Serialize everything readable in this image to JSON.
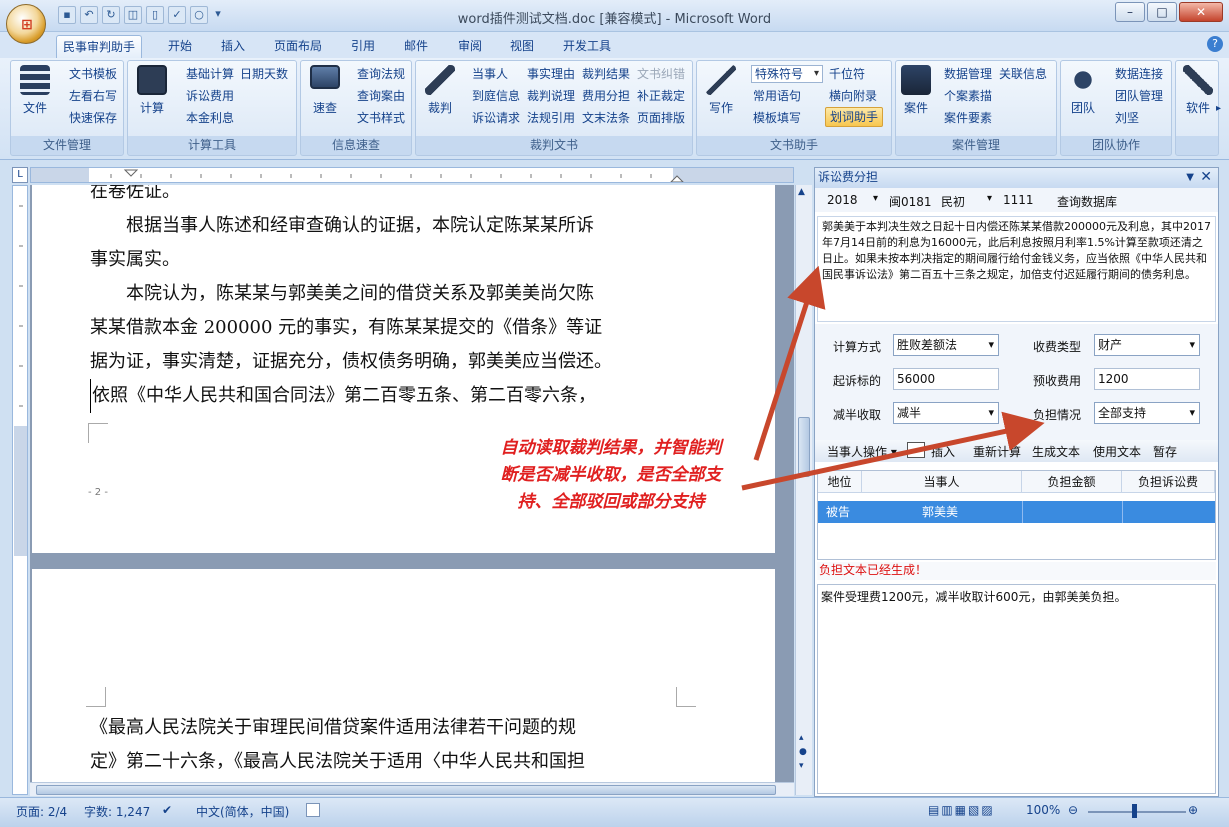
{
  "window": {
    "title": "word插件测试文档.doc [兼容模式] - Microsoft Word",
    "min": "–",
    "max": "□",
    "close": "✕"
  },
  "tabs": [
    "民事审判助手",
    "开始",
    "插入",
    "页面布局",
    "引用",
    "邮件",
    "审阅",
    "视图",
    "开发工具"
  ],
  "ribbon": {
    "file_group": {
      "label": "文件管理",
      "big": "文件",
      "items": [
        "文书模板",
        "左看右写",
        "快速保存"
      ]
    },
    "calc_group": {
      "label": "计算工具",
      "big": "计算",
      "items": [
        "基础计算",
        "日期天数",
        "诉讼费用",
        "本金利息"
      ]
    },
    "info_group": {
      "label": "信息速查",
      "big": "速查",
      "items": [
        "查询法规",
        "查询案由",
        "文书样式"
      ]
    },
    "judge_group": {
      "label": "裁判文书",
      "big": "裁判",
      "items": [
        "当事人",
        "事实理由",
        "裁判结果",
        "文书纠错",
        "到庭信息",
        "裁判说理",
        "费用分担",
        "补正裁定",
        "诉讼请求",
        "法规引用",
        "文末法条",
        "页面排版"
      ]
    },
    "write_group": {
      "label": "文书助手",
      "big": "写作",
      "combo": "特殊符号",
      "items": [
        "千位符",
        "常用语句",
        "横向附录",
        "模板填写"
      ],
      "highlight": "划词助手"
    },
    "case_group": {
      "label": "案件管理",
      "big": "案件",
      "items": [
        "数据管理",
        "关联信息",
        "个案素描",
        "案件要素"
      ]
    },
    "team_group": {
      "label": "团队协作",
      "big": "团队",
      "items": [
        "数据连接",
        "团队管理",
        "刘坚"
      ]
    },
    "soft_group": {
      "big": "软件"
    }
  },
  "document": {
    "page1_lines": [
      "在卷佐证。",
      "　　根据当事人陈述和经审查确认的证据，本院认定陈某某所诉",
      "事实属实。",
      "　　本院认为，陈某某与郭美美之间的借贷关系及郭美美尚欠陈",
      "某某借款本金 200000 元的事实，有陈某某提交的《借条》等证",
      "据为证，事实清楚，证据充分，债权债务明确，郭美美应当偿还。",
      "依照《中华人民共和国合同法》第二百零五条、第二百零六条，"
    ],
    "page_number": "- 2 -",
    "page2_lines": [
      "《最高人民法院关于审理民间借贷案件适用法律若干问题的规",
      "定》第二十六条，《最高人民法院关于适用〈中华人民共和国担"
    ]
  },
  "pane": {
    "title": "诉讼费分担",
    "case_year": "2018",
    "court_code": "闽0181",
    "case_type": "民初",
    "case_no": "1111",
    "query_db": "查询数据库",
    "judgment_text": "郭美美于本判决生效之日起十日内偿还陈某某借款200000元及利息，其中2017年7月14日前的利息为16000元，此后利息按照月利率1.5%计算至款项还清之日止。如果未按本判决指定的期间履行给付金钱义务，应当依照《中华人民共和国民事诉讼法》第二百五十三条之规定，加倍支付迟延履行期间的债务利息。",
    "fields": {
      "calc_method_label": "计算方式",
      "calc_method": "胜败差额法",
      "fee_type_label": "收费类型",
      "fee_type": "财产",
      "claim_label": "起诉标的",
      "claim": "56000",
      "prepaid_label": "预收费用",
      "prepaid": "1200",
      "halve_label": "减半收取",
      "halve": "减半",
      "burden_label": "负担情况",
      "burden": "全部支持"
    },
    "toolbar": [
      "当事人操作 ▾",
      "插入",
      "重新计算",
      "生成文本",
      "使用文本",
      "暂存"
    ],
    "table_headers": [
      "地位",
      "当事人",
      "负担金额",
      "负担诉讼费"
    ],
    "table_rows": [
      {
        "role": "被告",
        "party": "郭美美",
        "amount": "",
        "fee": ""
      }
    ],
    "status": "负担文本已经生成！",
    "generated_text": "案件受理费1200元，减半收取计600元，由郭美美负担。"
  },
  "annotation": "自动读取裁判结果，并智能判断是否减半收取，是否全部支持、全部驳回或部分支持",
  "statusbar": {
    "page": "页面: 2/4",
    "words": "字数: 1,247",
    "lang": "中文(简体，中国)",
    "zoom": "100%"
  }
}
